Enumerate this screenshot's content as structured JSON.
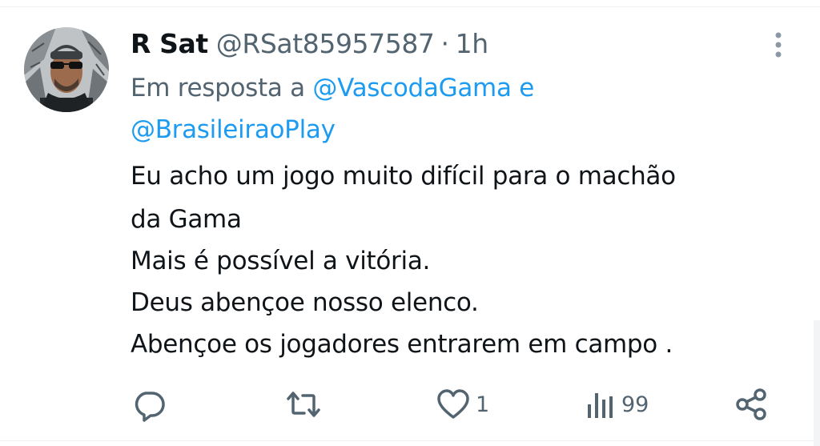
{
  "tweet": {
    "display_name": "R Sat",
    "handle": "@RSat85957587",
    "separator": "·",
    "time": "1h",
    "reply_prefix": "Em resposta a",
    "mention_1": "@VascodaGama",
    "reply_connector": "e",
    "mention_2": "@BrasileiraoPlay",
    "text_lines": [
      "Eu acho um jogo muito difícil para o machão",
      "da Gama",
      "Mais é possível a vitória.",
      "Deus abençoe nosso elenco.",
      "Abençoe os jogadores entrarem em campo  ."
    ]
  },
  "actions": {
    "reply_count": "",
    "retweet_count": "",
    "like_count": "1",
    "views_count": "99"
  },
  "icons": {
    "more": "more-vertical-icon",
    "reply": "reply-bubble-icon",
    "retweet": "retweet-icon",
    "like": "heart-icon",
    "views": "views-bar-chart-icon",
    "share": "share-icon"
  },
  "colors": {
    "text": "#0f1419",
    "muted": "#536471",
    "link": "#1d9bf0",
    "divider": "#eff3f4"
  }
}
